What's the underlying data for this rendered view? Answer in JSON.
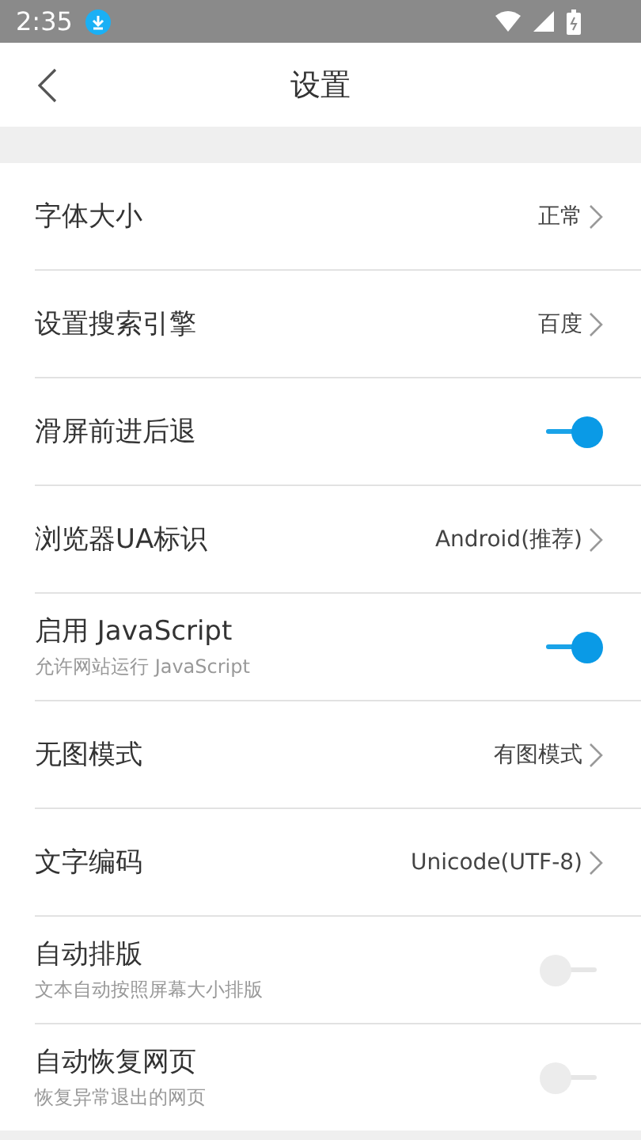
{
  "status_bar": {
    "time": "2:35"
  },
  "header": {
    "title": "设置"
  },
  "settings": [
    {
      "kind": "link",
      "label": "字体大小",
      "value": "正常"
    },
    {
      "kind": "link",
      "label": "设置搜索引擎",
      "value": "百度"
    },
    {
      "kind": "toggle",
      "label": "滑屏前进后退",
      "on": true
    },
    {
      "kind": "link",
      "label": "浏览器UA标识",
      "value": "Android(推荐)"
    },
    {
      "kind": "toggle",
      "label": "启用 JavaScript",
      "subtitle": "允许网站运行 JavaScript",
      "on": true
    },
    {
      "kind": "link",
      "label": "无图模式",
      "value": "有图模式"
    },
    {
      "kind": "link",
      "label": "文字编码",
      "value": "Unicode(UTF-8)"
    },
    {
      "kind": "toggle",
      "label": "自动排版",
      "subtitle": "文本自动按照屏幕大小排版",
      "on": false
    },
    {
      "kind": "toggle",
      "label": "自动恢复网页",
      "subtitle": "恢复异常退出的网页",
      "on": false
    }
  ]
}
